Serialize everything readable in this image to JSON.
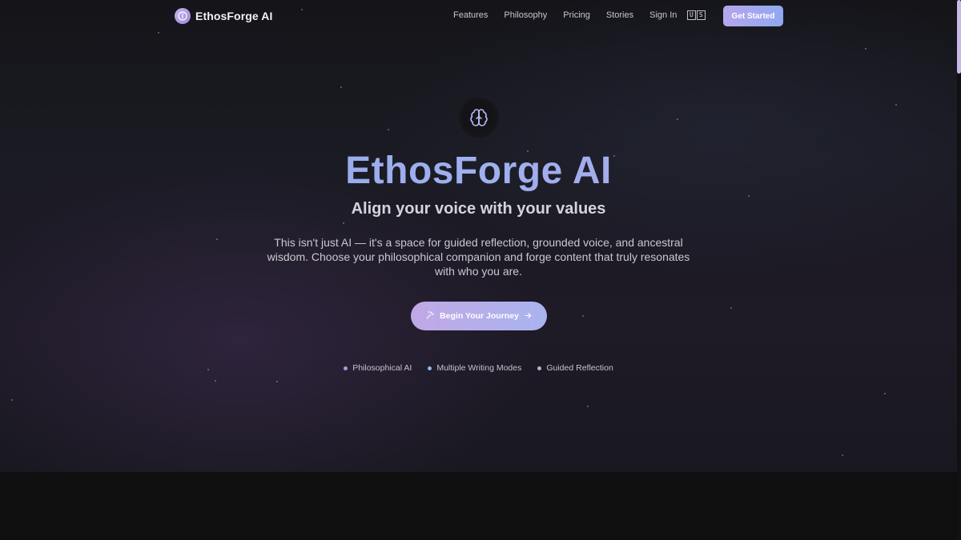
{
  "nav": {
    "brand": "EthosForge AI",
    "links": [
      "Features",
      "Philosophy",
      "Pricing",
      "Stories",
      "Sign In"
    ],
    "lang": [
      "U",
      "S"
    ],
    "cta": "Get Started"
  },
  "hero": {
    "icon": "brain-icon",
    "title": "EthosForge AI",
    "subtitle": "Align your voice with your values",
    "description": "This isn't just AI — it's a space for guided reflection, grounded voice, and ancestral wisdom. Choose your philosophical companion and forge content that truly resonates with who you are.",
    "button": "Begin Your Journey",
    "features": [
      {
        "label": "Philosophical AI",
        "color": "#a99ae0"
      },
      {
        "label": "Multiple Writing Modes",
        "color": "#8fb6f0"
      },
      {
        "label": "Guided Reflection",
        "color": "#b6b0d8"
      }
    ]
  },
  "colors": {
    "accent_start": "#b7a6ec",
    "accent_end": "#8fa8f0",
    "title_gradient": [
      "#8fa0e6",
      "#b3a2e8"
    ],
    "background": "#16161c"
  }
}
